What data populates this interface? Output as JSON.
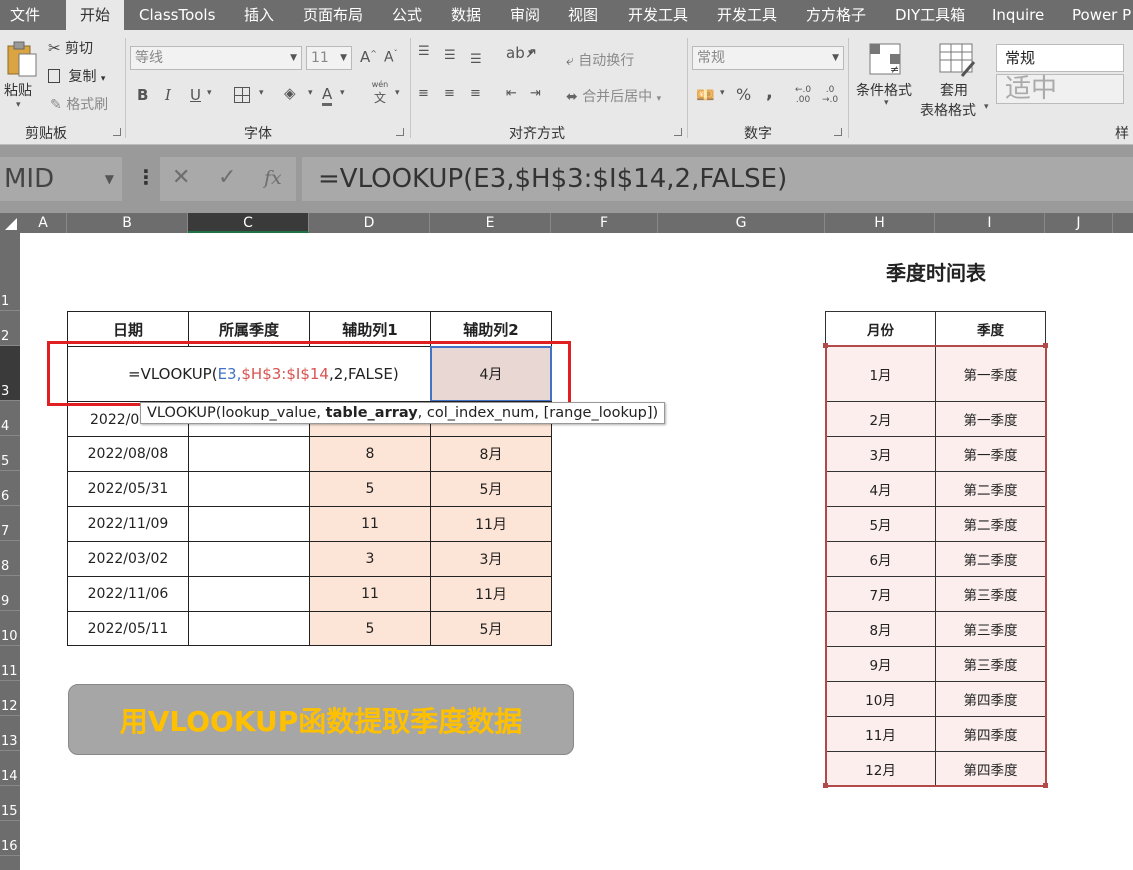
{
  "ribbon_tabs": [
    "文件",
    "开始",
    "ClassTools",
    "插入",
    "页面布局",
    "公式",
    "数据",
    "审阅",
    "视图",
    "开发工具",
    "开发工具",
    "方方格子",
    "DIY工具箱",
    "Inquire",
    "Power P"
  ],
  "active_tab": "开始",
  "clipboard": {
    "paste": "粘贴",
    "cut": "剪切",
    "copy": "复制",
    "format_painter": "格式刷",
    "label": "剪贴板"
  },
  "font": {
    "name": "等线",
    "size": "11",
    "label": "字体",
    "bold": "B",
    "italic": "I",
    "underline": "U",
    "grow": "A",
    "shrink": "A",
    "color_a": "A",
    "phonetic_top": "wén",
    "phonetic": "文"
  },
  "alignment": {
    "wrap_text": "自动换行",
    "merge_center": "合并后居中",
    "label": "对齐方式"
  },
  "number": {
    "format": "常规",
    "percent": "%",
    "comma": ",",
    "inc_decimal": ".00",
    "dec_decimal": ".0",
    "label": "数字"
  },
  "styles": {
    "conditional": "条件格式",
    "table_format_1": "套用",
    "table_format_2": "表格格式",
    "normal": "常规",
    "medium": "适中",
    "label": "样"
  },
  "formula_bar": {
    "name_box": "MID",
    "cancel": "✕",
    "enter": "✓",
    "fx": "fx",
    "formula": "=VLOOKUP(E3,$H$3:$I$14,2,FALSE)"
  },
  "columns": [
    "A",
    "B",
    "C",
    "D",
    "E",
    "F",
    "G",
    "H",
    "I",
    "J"
  ],
  "rows": [
    "1",
    "2",
    "3",
    "4",
    "5",
    "6",
    "7",
    "8",
    "9",
    "10",
    "11",
    "12",
    "13",
    "14",
    "15",
    "16"
  ],
  "main_table": {
    "headers": [
      "日期",
      "所属季度",
      "辅助列1",
      "辅助列2"
    ],
    "edit_row": {
      "prefix": "=VLOOKUP(",
      "arg1": "E3",
      "comma1": ",",
      "arg2": "$H$3:$I$14",
      "rest": ",2,FALSE)",
      "e_value": "4月"
    },
    "rows": [
      {
        "date": "2022/09",
        "quarter": "",
        "aux1": "",
        "aux2": ""
      },
      {
        "date": "2022/08/08",
        "quarter": "",
        "aux1": "8",
        "aux2": "8月"
      },
      {
        "date": "2022/05/31",
        "quarter": "",
        "aux1": "5",
        "aux2": "5月"
      },
      {
        "date": "2022/11/09",
        "quarter": "",
        "aux1": "11",
        "aux2": "11月"
      },
      {
        "date": "2022/03/02",
        "quarter": "",
        "aux1": "3",
        "aux2": "3月"
      },
      {
        "date": "2022/11/06",
        "quarter": "",
        "aux1": "11",
        "aux2": "11月"
      },
      {
        "date": "2022/05/11",
        "quarter": "",
        "aux1": "5",
        "aux2": "5月"
      }
    ]
  },
  "tooltip": {
    "func": "VLOOKUP(lookup_value, ",
    "bold_arg": "table_array",
    "rest": ", col_index_num, [range_lookup])"
  },
  "banner": "用VLOOKUP函数提取季度数据",
  "quarter_table": {
    "title": "季度时间表",
    "headers": [
      "月份",
      "季度"
    ],
    "rows": [
      [
        "1月",
        "第一季度"
      ],
      [
        "2月",
        "第一季度"
      ],
      [
        "3月",
        "第一季度"
      ],
      [
        "4月",
        "第二季度"
      ],
      [
        "5月",
        "第二季度"
      ],
      [
        "6月",
        "第二季度"
      ],
      [
        "7月",
        "第三季度"
      ],
      [
        "8月",
        "第三季度"
      ],
      [
        "9月",
        "第三季度"
      ],
      [
        "10月",
        "第四季度"
      ],
      [
        "11月",
        "第四季度"
      ],
      [
        "12月",
        "第四季度"
      ]
    ]
  },
  "colors": {
    "ribbon_dark": "#6d6d6d",
    "ribbon_light": "#e8e8e8",
    "peach": "#fce4d6",
    "highlight_red": "#e02020",
    "banner_text": "#ffc000"
  }
}
